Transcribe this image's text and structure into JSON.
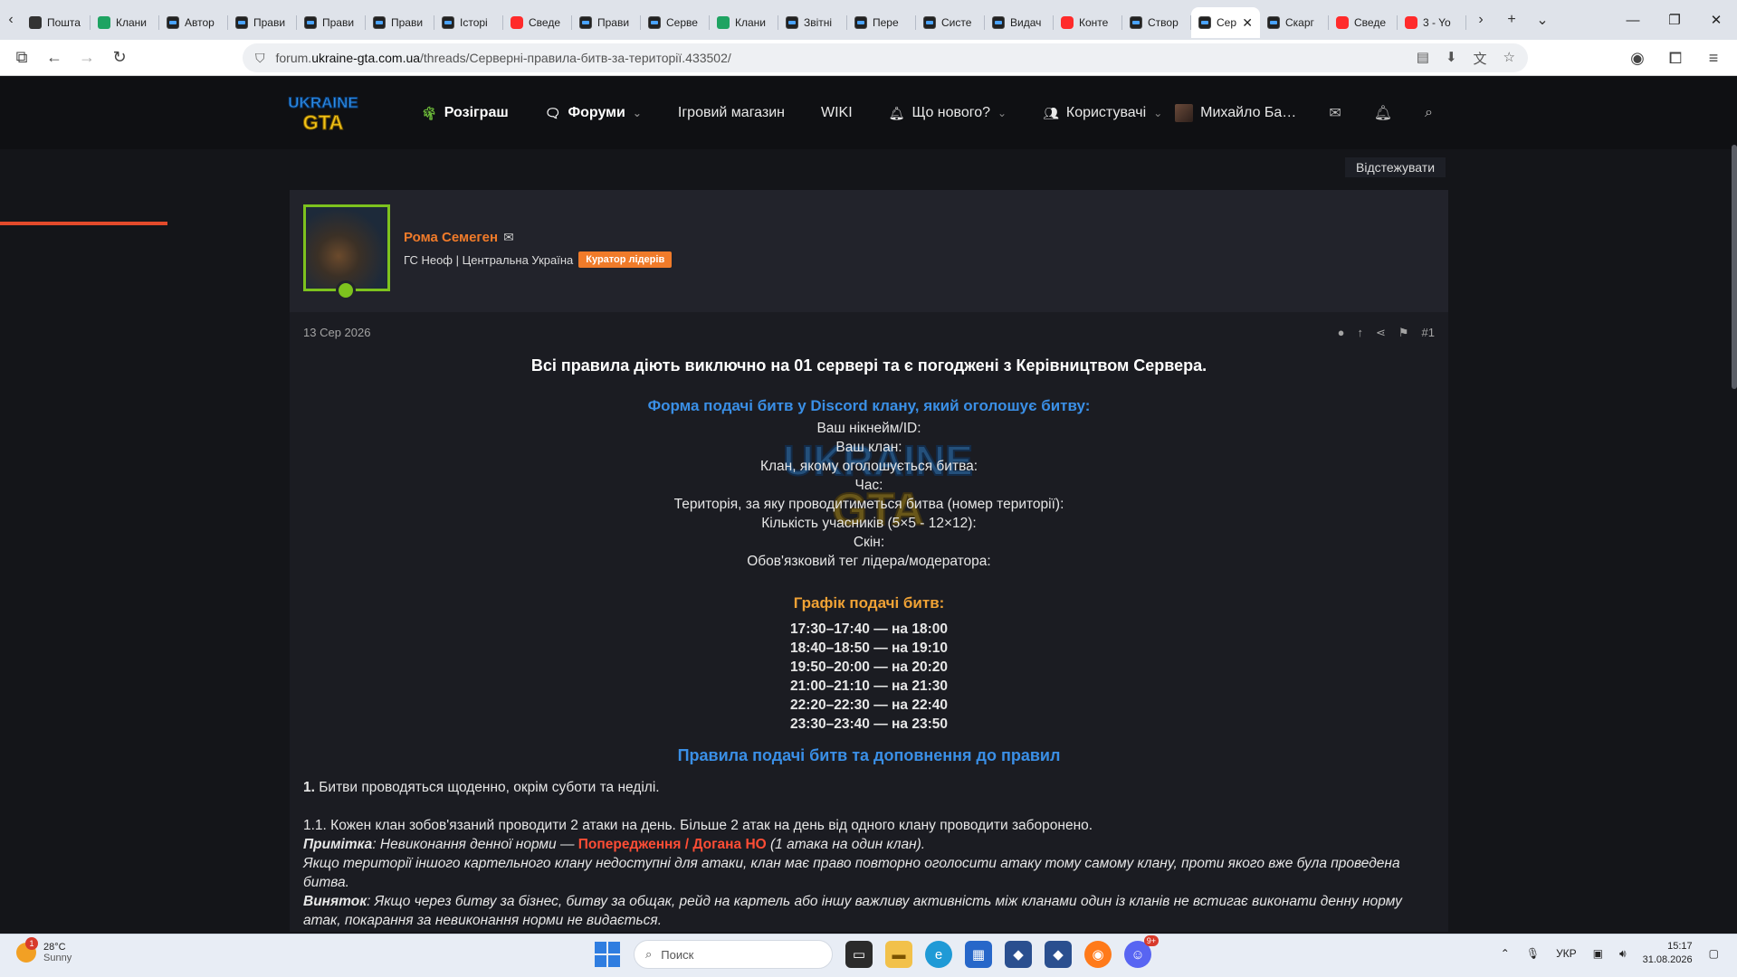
{
  "browser": {
    "tabs": [
      {
        "title": "Пошта",
        "icon": "mail-icon",
        "fav": "mail"
      },
      {
        "title": "Клани",
        "icon": "sheet-icon",
        "fav": "sheet"
      },
      {
        "title": "Автор",
        "icon": "forum-icon",
        "fav": "dark"
      },
      {
        "title": "Прави",
        "icon": "forum-icon",
        "fav": "dark"
      },
      {
        "title": "Прави",
        "icon": "forum-icon",
        "fav": "dark"
      },
      {
        "title": "Прави",
        "icon": "forum-icon",
        "fav": "dark"
      },
      {
        "title": "Історі",
        "icon": "forum-icon",
        "fav": "dark"
      },
      {
        "title": "Сведе",
        "icon": "youtube-icon",
        "fav": "yt"
      },
      {
        "title": "Прави",
        "icon": "forum-icon",
        "fav": "dark"
      },
      {
        "title": "Серве",
        "icon": "forum-icon",
        "fav": "dark"
      },
      {
        "title": "Клани",
        "icon": "sheet-icon",
        "fav": "sheet"
      },
      {
        "title": "Звітні",
        "icon": "forum-icon",
        "fav": "dark"
      },
      {
        "title": "Пере",
        "icon": "forum-icon",
        "fav": "dark"
      },
      {
        "title": "Систе",
        "icon": "forum-icon",
        "fav": "dark"
      },
      {
        "title": "Видач",
        "icon": "forum-icon",
        "fav": "dark"
      },
      {
        "title": "Конте",
        "icon": "youtube-icon",
        "fav": "yt"
      },
      {
        "title": "Створ",
        "icon": "forum-icon",
        "fav": "dark"
      },
      {
        "title": "Сер",
        "icon": "forum-icon",
        "fav": "dark",
        "active": true
      },
      {
        "title": "Скарг",
        "icon": "forum-icon",
        "fav": "dark"
      },
      {
        "title": "Сведе",
        "icon": "youtube-icon",
        "fav": "yt"
      },
      {
        "title": "3 - Yo",
        "icon": "youtube-icon",
        "fav": "yt"
      }
    ],
    "url_prefix": "forum.",
    "url_domain": "ukraine-gta.com.ua",
    "url_path": "/threads/Серверні-правила-битв-за-території.433502/"
  },
  "header": {
    "nav": [
      {
        "label": "Розіграш",
        "icon": "palm-icon",
        "bold": true,
        "caret": false
      },
      {
        "label": "Форуми",
        "icon": "chat-icon",
        "bold": true,
        "caret": true
      },
      {
        "label": "Ігровий магазин",
        "icon": "",
        "bold": false,
        "caret": false
      },
      {
        "label": "WIKI",
        "icon": "",
        "bold": false,
        "caret": false
      },
      {
        "label": "Що нового?",
        "icon": "bell-icon",
        "bold": false,
        "caret": true
      },
      {
        "label": "Користувачі",
        "icon": "users-icon",
        "bold": false,
        "caret": true
      }
    ],
    "user_name": "Михайло Ба…"
  },
  "thread": {
    "watch_label": "Відстежувати"
  },
  "post": {
    "author": "Рома Семеген",
    "author_title": "ГС Неоф | Центральна Україна",
    "badge": "Куратор лідерів",
    "date": "13 Сер 2026",
    "number": "#1",
    "heading": "Всі правила діють виключно на 01 сервері та є погоджені з Керівництвом Сервера.",
    "form_heading": "Форма подачі битв у Discord клану, який оголошує битву:",
    "form_lines": [
      "Ваш нікнейм/ID:",
      "Ваш клан:",
      "Клан, якому оголошується битва:",
      "Час:",
      "Територія, за яку проводитиметься битва (номер території):",
      "Кількість учасників (5×5 - 12×12):",
      "Скін:",
      "Обов'язковий тег лідера/модератора:"
    ],
    "schedule_heading": "Графік подачі битв:",
    "schedule": [
      "17:30–17:40 — на 18:00",
      "18:40–18:50 — на 19:10",
      "19:50–20:00 — на 20:20",
      "21:00–21:10 — на 21:30",
      "22:20–22:30 — на 22:40",
      "23:30–23:40 — на 23:50"
    ],
    "rules_heading": "Правила подачі битв та доповнення до правил",
    "rule1_num": "1.",
    "rule1_text": " Битви проводяться щоденно, окрім суботи та неділі.",
    "rule11": "1.1. Кожен клан зобов'язаний проводити 2 атаки на день. Більше 2 атак на день від одного клану проводити заборонено.",
    "note_label": "Примітка",
    "note_pre": ": Невиконання денної норми — ",
    "note_red": "Попередження / Догана НО",
    "note_post": " (1 атака на один клан).",
    "note2": "Якщо території іншого картельного клану недоступні для атаки, клан має право повторно оголосити атаку тому самому клану, проти якого вже була проведена битва.",
    "exception_label": "Виняток",
    "exception_text": ": Якщо через битву за бізнес, битву за общак, рейд на картель або іншу важливу активність між кланами один із кланів не встигає виконати денну норму атак, покарання за невиконання норми не видається."
  },
  "taskbar": {
    "temp": "28°C",
    "weather": "Sunny",
    "weather_badge": "1",
    "search_placeholder": "Поиск",
    "lang": "УКР",
    "time": "15:17",
    "date": "31.08.2026",
    "discord_badge": "9+"
  },
  "colors": {
    "accent_orange": "#f07b2a",
    "heading_blue": "#3a8fe6",
    "heading_orange": "#f0a235",
    "warning_red": "#ff4d35",
    "online_green": "#7dc21e"
  }
}
